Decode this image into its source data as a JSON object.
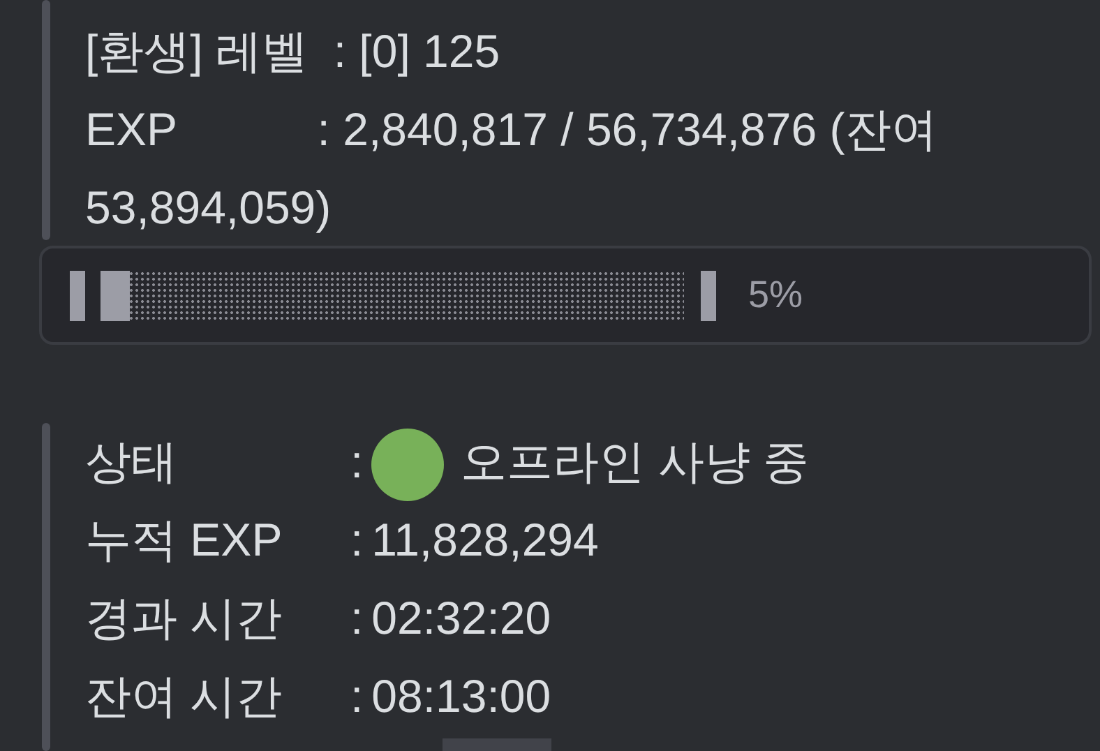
{
  "level_block": {
    "lines": [
      "[환생] 레벨  : [0] 125",
      "EXP           : 2,840,817 / 56,734,876 (잔여 53,894,059)"
    ]
  },
  "exp_bar": {
    "level": 0.05,
    "reading": "5%"
  },
  "status_block": {
    "lines": [
      {
        "kind": "status",
        "label": "상태",
        "colon": ":",
        "value": "오프라인 사냥 중"
      },
      {
        "kind": "plain",
        "label": "누적 EXP",
        "colon": ":",
        "value": "11,828,294"
      },
      {
        "kind": "plain",
        "label": "경과 시간",
        "colon": ":",
        "value": "02:32:20"
      },
      {
        "kind": "plain",
        "label": "잔여 시간",
        "colon": ":",
        "value": "08:13:00"
      }
    ]
  }
}
